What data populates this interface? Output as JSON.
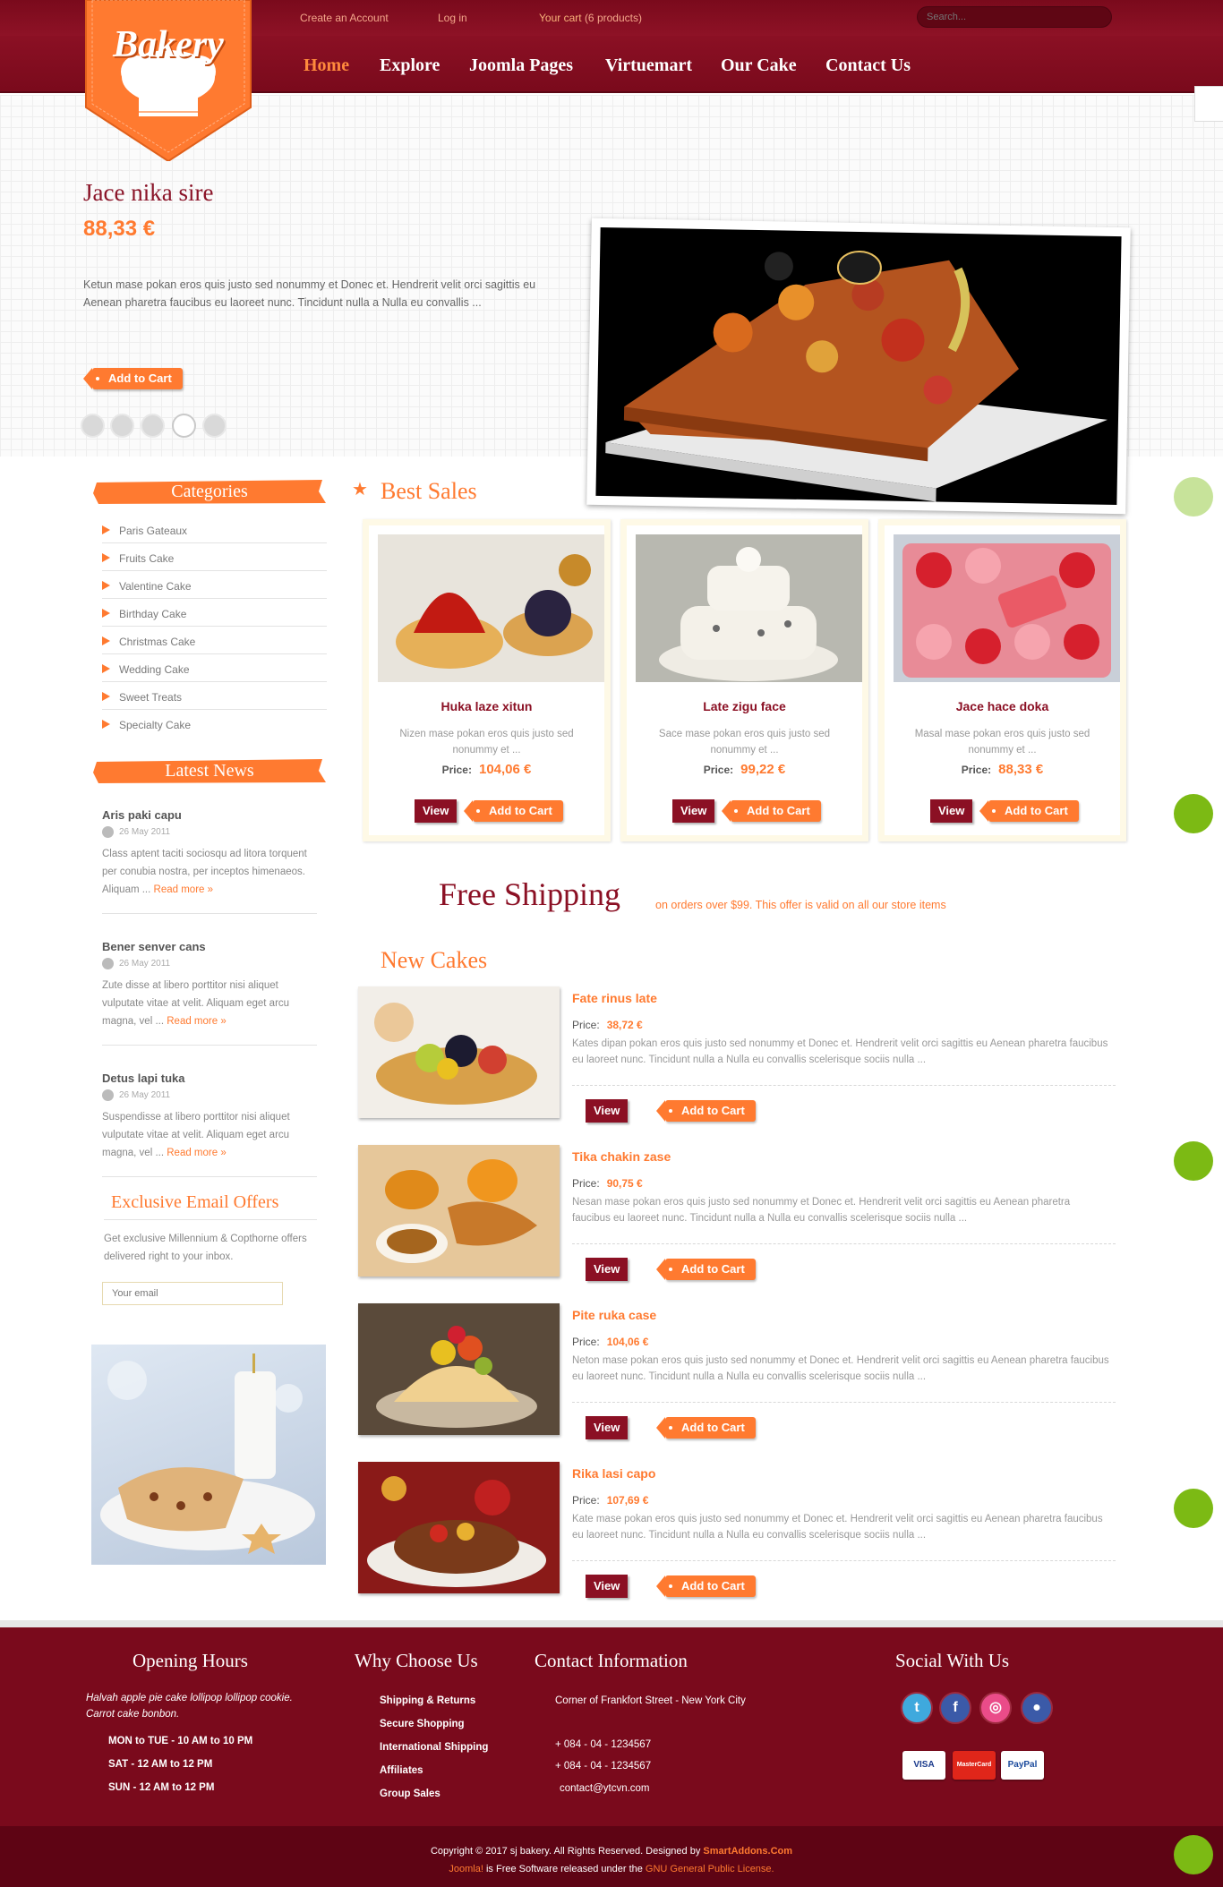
{
  "header": {
    "create_account": "Create an Account",
    "login": "Log in",
    "cart_label": "Your cart",
    "cart_count": "(6 products)",
    "search_placeholder": "Search...",
    "logo_text": "Bakery",
    "nav": [
      {
        "label": "Home",
        "active": true
      },
      {
        "label": "Explore",
        "active": false
      },
      {
        "label": "Joomla Pages",
        "active": false
      },
      {
        "label": "Virtuemart",
        "active": false
      },
      {
        "label": "Our Cake",
        "active": false
      },
      {
        "label": "Contact Us",
        "active": false
      }
    ]
  },
  "hero": {
    "title": "Jace nika sire",
    "price": "88,33 €",
    "description": "Ketun mase pokan eros quis justo sed nonummy et Donec et. Hendrerit velit orci sagittis eu Aenean pharetra faucibus eu laoreet nunc. Tincidunt nulla a Nulla eu convallis ...",
    "add_to_cart": "Add to Cart",
    "slides": 5,
    "active_slide": 4
  },
  "sidebar": {
    "categories_heading": "Categories",
    "categories": [
      "Paris Gateaux",
      "Fruits Cake",
      "Valentine Cake",
      "Birthday Cake",
      "Christmas Cake",
      "Wedding Cake",
      "Sweet Treats",
      "Specialty Cake"
    ],
    "news_heading": "Latest News",
    "news": [
      {
        "title": "Aris paki capu",
        "date": "26 May 2011",
        "text": "Class aptent taciti sociosqu ad litora torquent per conubia nostra, per inceptos himenaeos. Aliquam ...",
        "more": "Read more »"
      },
      {
        "title": "Bener senver cans",
        "date": "26 May 2011",
        "text": "Zute disse at libero porttitor nisi aliquet vulputate vitae at velit. Aliquam eget arcu magna, vel ...",
        "more": "Read more »"
      },
      {
        "title": "Detus lapi tuka",
        "date": "26 May 2011",
        "text": "Suspendisse at libero porttitor nisi aliquet vulputate vitae at velit. Aliquam eget arcu magna, vel ...",
        "more": "Read more »"
      }
    ],
    "email_heading": "Exclusive Email Offers",
    "email_text": "Get exclusive Millennium & Copthorne offers delivered right to your inbox.",
    "email_placeholder": "Your email"
  },
  "best_sales": {
    "heading": "Best Sales",
    "view_label": "View",
    "cart_label": "Add to Cart",
    "price_label": "Price:",
    "items": [
      {
        "name": "Huka laze xitun",
        "desc": "Nizen mase pokan eros quis justo sed nonummy et ...",
        "price": "104,06 €"
      },
      {
        "name": "Late zigu face",
        "desc": "Sace mase pokan eros quis justo sed nonummy et ...",
        "price": "99,22 €"
      },
      {
        "name": "Jace hace doka",
        "desc": "Masal mase pokan eros quis justo sed nonummy et ...",
        "price": "88,33 €"
      }
    ]
  },
  "shipping": {
    "title": "Free Shipping",
    "text": "on orders over $99. This offer is valid on all our store items"
  },
  "new_cakes": {
    "heading": "New Cakes",
    "view_label": "View",
    "cart_label": "Add to Cart",
    "price_label": "Price:",
    "items": [
      {
        "name": "Fate rinus late",
        "price": "38,72 €",
        "desc": "Kates dipan pokan eros quis justo sed nonummy et Donec et. Hendrerit velit orci sagittis eu Aenean pharetra faucibus eu laoreet nunc. Tincidunt nulla a Nulla eu convallis scelerisque sociis nulla ..."
      },
      {
        "name": "Tika chakin zase",
        "price": "90,75 €",
        "desc": "Nesan mase pokan eros quis justo sed nonummy et Donec et. Hendrerit velit orci sagittis eu Aenean pharetra faucibus eu laoreet nunc. Tincidunt nulla a Nulla eu convallis scelerisque sociis nulla ..."
      },
      {
        "name": "Pite ruka case",
        "price": "104,06 €",
        "desc": "Neton mase pokan eros quis justo sed nonummy et Donec et. Hendrerit velit orci sagittis eu Aenean pharetra faucibus eu laoreet nunc. Tincidunt nulla a Nulla eu convallis scelerisque sociis nulla ..."
      },
      {
        "name": "Rika lasi capo",
        "price": "107,69 €",
        "desc": "Kate mase pokan eros quis justo sed nonummy et Donec et. Hendrerit velit orci sagittis eu Aenean pharetra faucibus eu laoreet nunc. Tincidunt nulla a Nulla eu convallis scelerisque sociis nulla ..."
      }
    ]
  },
  "footer": {
    "hours_heading": "Opening Hours",
    "hours_intro": "Halvah apple pie cake lollipop lollipop cookie. Carrot cake bonbon.",
    "hours": [
      "MON to TUE - 10 AM to 10 PM",
      "SAT - 12 AM to 12 PM",
      "SUN - 12 AM to 12 PM"
    ],
    "why_heading": "Why Choose Us",
    "why": [
      "Shipping & Returns",
      "Secure Shopping",
      "International Shipping",
      "Affiliates",
      "Group Sales"
    ],
    "contact_heading": "Contact Information",
    "address": "Corner of Frankfort Street - New York City",
    "phones": [
      "+ 084 - 04 - 1234567",
      "+ 084 - 04 - 1234567"
    ],
    "email": "contact@ytcvn.com",
    "social_heading": "Social With Us",
    "social": [
      "twitter-icon",
      "facebook-icon",
      "dribbble-icon",
      "flickr-icon"
    ],
    "payments": [
      "VISA",
      "MasterCard",
      "PayPal"
    ],
    "copyright": "Copyright © 2017 sj bakery. All Rights Reserved. Designed by",
    "designer": "SmartAddons.Com",
    "joomla": "Joomla!",
    "joomla_text": "is Free Software released under the",
    "license": "GNU General Public License."
  },
  "colors": {
    "brand": "#8b1024",
    "accent": "#ff7a30",
    "green": "#7cba14"
  }
}
